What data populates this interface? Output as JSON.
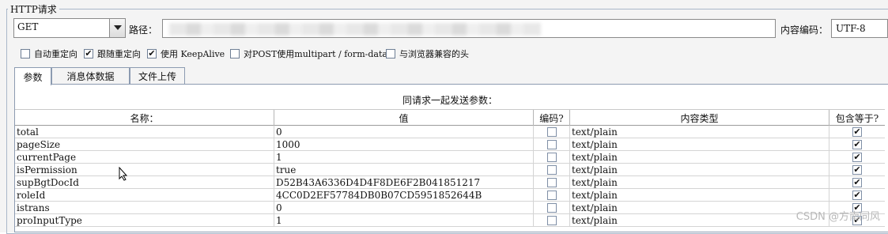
{
  "section_title": "HTTP请求",
  "method": {
    "value": "GET"
  },
  "path": {
    "label": "路径：",
    "value": ""
  },
  "encoding": {
    "label": "内容编码：",
    "value": "UTF-8"
  },
  "options": [
    {
      "label": "自动重定向",
      "checked": false
    },
    {
      "label": "跟随重定向",
      "checked": true
    },
    {
      "label": "使用 KeepAlive",
      "checked": true
    },
    {
      "label": "对POST使用multipart / form-data",
      "checked": false
    },
    {
      "label": "与浏览器兼容的头",
      "checked": false
    }
  ],
  "tabs": [
    "参数",
    "消息体数据",
    "文件上传"
  ],
  "params": {
    "caption": "同请求一起发送参数：",
    "columns": [
      "名称：",
      "值",
      "编码?",
      "内容类型",
      "包含等于?"
    ],
    "rows": [
      {
        "name": "total",
        "value": "0",
        "encode": false,
        "content_type": "text/plain",
        "include_equals": true
      },
      {
        "name": "pageSize",
        "value": "1000",
        "encode": false,
        "content_type": "text/plain",
        "include_equals": true
      },
      {
        "name": "currentPage",
        "value": "1",
        "encode": false,
        "content_type": "text/plain",
        "include_equals": true
      },
      {
        "name": "isPermission",
        "value": "true",
        "encode": false,
        "content_type": "text/plain",
        "include_equals": true
      },
      {
        "name": "supBgtDocId",
        "value": "D52B43A6336D4D4F8DE6F2B041851217",
        "encode": false,
        "content_type": "text/plain",
        "include_equals": true
      },
      {
        "name": "roleId",
        "value": "4CC0D2EF57784DB0B07CD5951852644B",
        "encode": false,
        "content_type": "text/plain",
        "include_equals": true
      },
      {
        "name": "istrans",
        "value": "0",
        "encode": false,
        "content_type": "text/plain",
        "include_equals": true
      },
      {
        "name": "proInputType",
        "value": "1",
        "encode": false,
        "content_type": "text/plain",
        "include_equals": true
      }
    ]
  },
  "watermark": "CSDN @方南同风",
  "icons": {
    "dropdown": "chevron-down-icon",
    "check": "check-icon",
    "cursor": "mouse-pointer-icon"
  }
}
